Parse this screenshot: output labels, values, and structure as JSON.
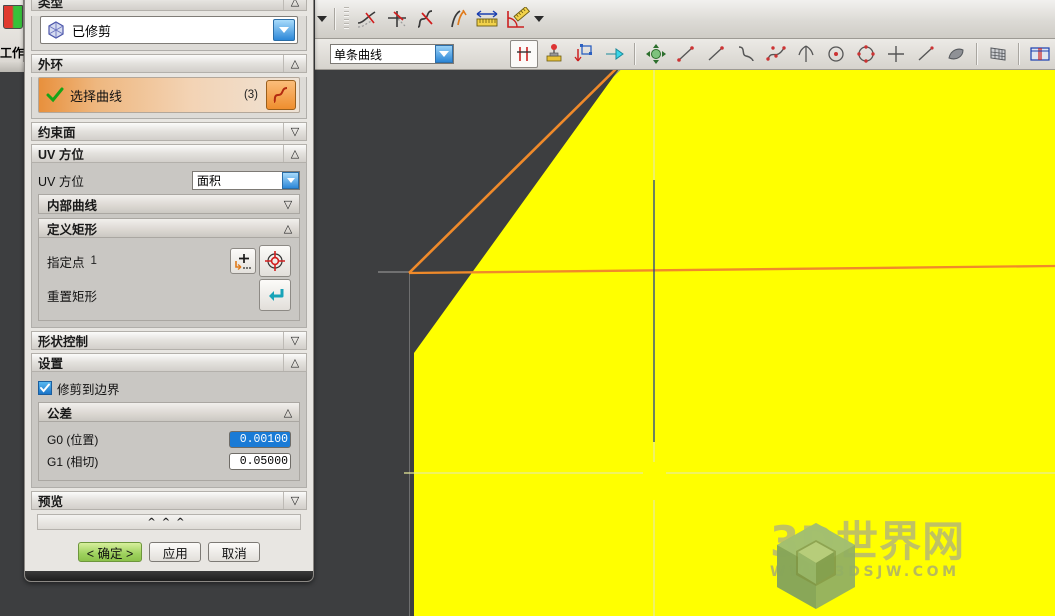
{
  "viewport": {
    "name": "3d-viewport",
    "bg_color": "#3d3e40",
    "surface_color": "#ffff00",
    "outline_color": "#f08a2a",
    "crosshair_color": "#e8ec9a",
    "edge_color": "#8e8e8e"
  },
  "watermark": {
    "main": "3D世界网",
    "sub": "WWW.3DSJW.COM"
  },
  "left_strip": {
    "text": "工作",
    "icon": "red-green-book-icon"
  },
  "toolbar_row1": {
    "caret_label": "▾",
    "buttons": [
      {
        "name": "trim-curve-icon",
        "title": "修剪曲线"
      },
      {
        "name": "trim-corner-icon",
        "title": "修剪拐角"
      },
      {
        "name": "divide-curve-icon",
        "title": "分割曲线"
      },
      {
        "name": "stretch-curve-icon",
        "title": "拉伸曲线"
      },
      {
        "name": "length-dimension-icon",
        "title": "曲线长度"
      },
      {
        "name": "measure-ruler-icon",
        "title": "测量"
      }
    ],
    "end_caret_label": "▾"
  },
  "toolbar_row2": {
    "curve_rule_combo": {
      "value": "单条曲线",
      "placeholder": "单条曲线"
    },
    "buttons": [
      {
        "name": "stop-at-intersection-icon",
        "title": "在交点处停止"
      },
      {
        "name": "snap-point-icon",
        "title": "捕捉点"
      },
      {
        "name": "create-curve-icon",
        "title": "创建曲线"
      },
      {
        "name": "arrow-right-icon",
        "title": "下一步"
      },
      {
        "name": "move-object-icon",
        "title": "移动对象"
      },
      {
        "name": "line-icon",
        "title": "直线"
      },
      {
        "name": "line2-icon",
        "title": "直线2"
      },
      {
        "name": "spline-icon",
        "title": "样条"
      },
      {
        "name": "studio-spline-icon",
        "title": "艺术样条"
      },
      {
        "name": "helix-icon",
        "title": "螺旋线"
      },
      {
        "name": "circle-center-icon",
        "title": "圆心圆"
      },
      {
        "name": "circle-points-icon",
        "title": "点圆"
      },
      {
        "name": "point-icon",
        "title": "点"
      },
      {
        "name": "line-simple-icon",
        "title": "直线简单"
      },
      {
        "name": "surface-icon",
        "title": "曲面"
      },
      {
        "name": "grid-icon",
        "title": "栅格"
      },
      {
        "name": "section-view-icon",
        "title": "剖视图"
      }
    ]
  },
  "dialog": {
    "sections": {
      "type": {
        "title": "类型",
        "chevron": "collapse",
        "combo": {
          "value": "已修剪",
          "icon": "trimmed-surface-icon"
        }
      },
      "outer_loop": {
        "title": "外环",
        "chevron": "collapse",
        "select_row": {
          "check_icon": "green-check-icon",
          "label": "选择曲线",
          "count": "(3)",
          "action_icon": "curve-select-icon"
        }
      },
      "constraint_face": {
        "title": "约束面",
        "chevron": "expand"
      },
      "uv_orientation": {
        "title": "UV 方位",
        "chevron": "collapse",
        "uv_field": {
          "label": "UV 方位",
          "value": "面积"
        },
        "inner_curves": {
          "title": "内部曲线",
          "chevron": "expand"
        },
        "define_rect": {
          "title": "定义矩形",
          "chevron": "collapse",
          "point_row": {
            "label": "指定点",
            "number": "1",
            "buttons": [
              {
                "name": "specify-point-icon",
                "title": "指定点"
              },
              {
                "name": "point-constructor-icon",
                "title": "点构造器"
              }
            ]
          },
          "reset_row": {
            "label": "重置矩形",
            "button": {
              "name": "reset-rectangle-icon",
              "title": "重置矩形"
            }
          }
        }
      },
      "shape_control": {
        "title": "形状控制",
        "chevron": "expand"
      },
      "settings": {
        "title": "设置",
        "chevron": "collapse",
        "trim_to_boundary": {
          "label": "修剪到边界",
          "checked": true
        },
        "tolerance": {
          "title": "公差",
          "chevron": "collapse",
          "rows": [
            {
              "label": "G0 (位置)",
              "value": "0.00100",
              "selected": true
            },
            {
              "label": "G1 (相切)",
              "value": "0.05000",
              "selected": false
            }
          ]
        }
      },
      "preview": {
        "title": "预览",
        "chevron": "expand"
      }
    },
    "collapse_strip": "^^^",
    "footer": {
      "ok": "< 确定 >",
      "apply": "应用",
      "cancel": "取消"
    }
  }
}
